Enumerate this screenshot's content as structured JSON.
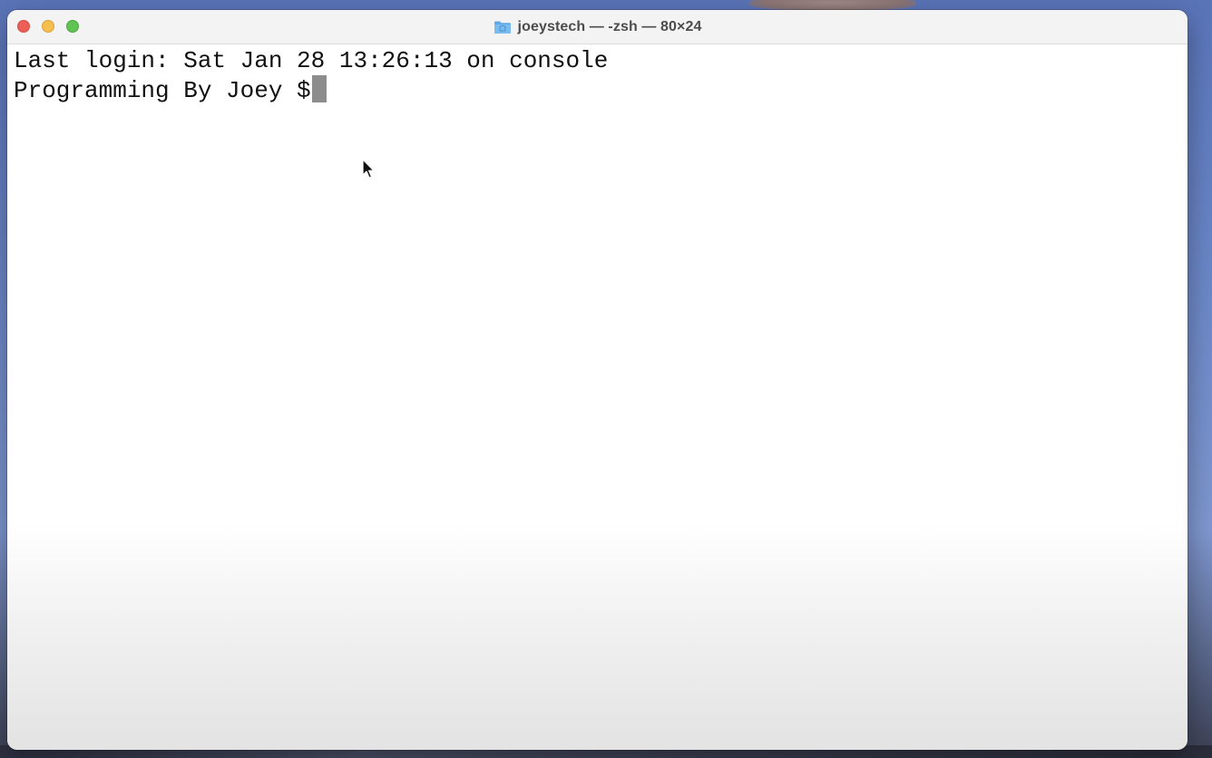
{
  "window": {
    "title": "joeystech — -zsh — 80×24",
    "title_icon": "folder-icon",
    "buttons": {
      "close": "close-button",
      "minimize": "minimize-button",
      "zoom": "zoom-button"
    }
  },
  "terminal": {
    "last_login": "Last login: Sat Jan 28 13:26:13 on console",
    "prompt": "Programming By Joey $"
  },
  "colors": {
    "close": "#ec5f57",
    "minimize": "#f5be4f",
    "zoom": "#5fc454",
    "cursor": "#8c8c8c",
    "title_text": "#4c4c4c",
    "terminal_text": "#111111"
  }
}
